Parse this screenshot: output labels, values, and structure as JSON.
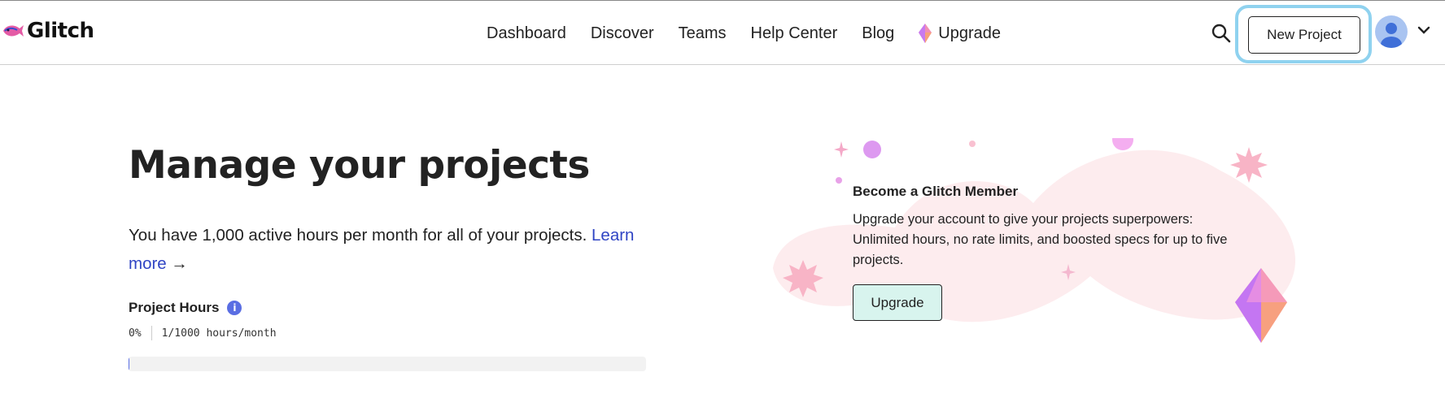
{
  "brand": {
    "name": "Glitch",
    "accent": "#2f44c4"
  },
  "nav": {
    "items": [
      "Dashboard",
      "Discover",
      "Teams",
      "Help Center",
      "Blog"
    ],
    "upgrade_label": "Upgrade"
  },
  "header_actions": {
    "new_project_label": "New Project",
    "search_icon": "search-icon",
    "avatar_icon": "avatar"
  },
  "main": {
    "title": "Manage your projects",
    "description": "You have 1,000 active hours per month for all of your projects.",
    "learn_more": "Learn more",
    "arrow": "→"
  },
  "project_hours": {
    "label": "Project Hours",
    "info_glyph": "i",
    "percent_text": "0%",
    "usage_text": "1/1000 hours/month",
    "progress_fraction": 0.001
  },
  "promo": {
    "title": "Become a Glitch Member",
    "text": "Upgrade your account to give your projects superpowers: Unlimited hours, no rate limits, and boosted specs for up to five projects.",
    "button_label": "Upgrade"
  },
  "colors": {
    "focus_ring": "#8fd2ef",
    "upgrade_button_bg": "#d8f4ee",
    "info_icon": "#5a6ee3",
    "blob": "#fdecee"
  }
}
